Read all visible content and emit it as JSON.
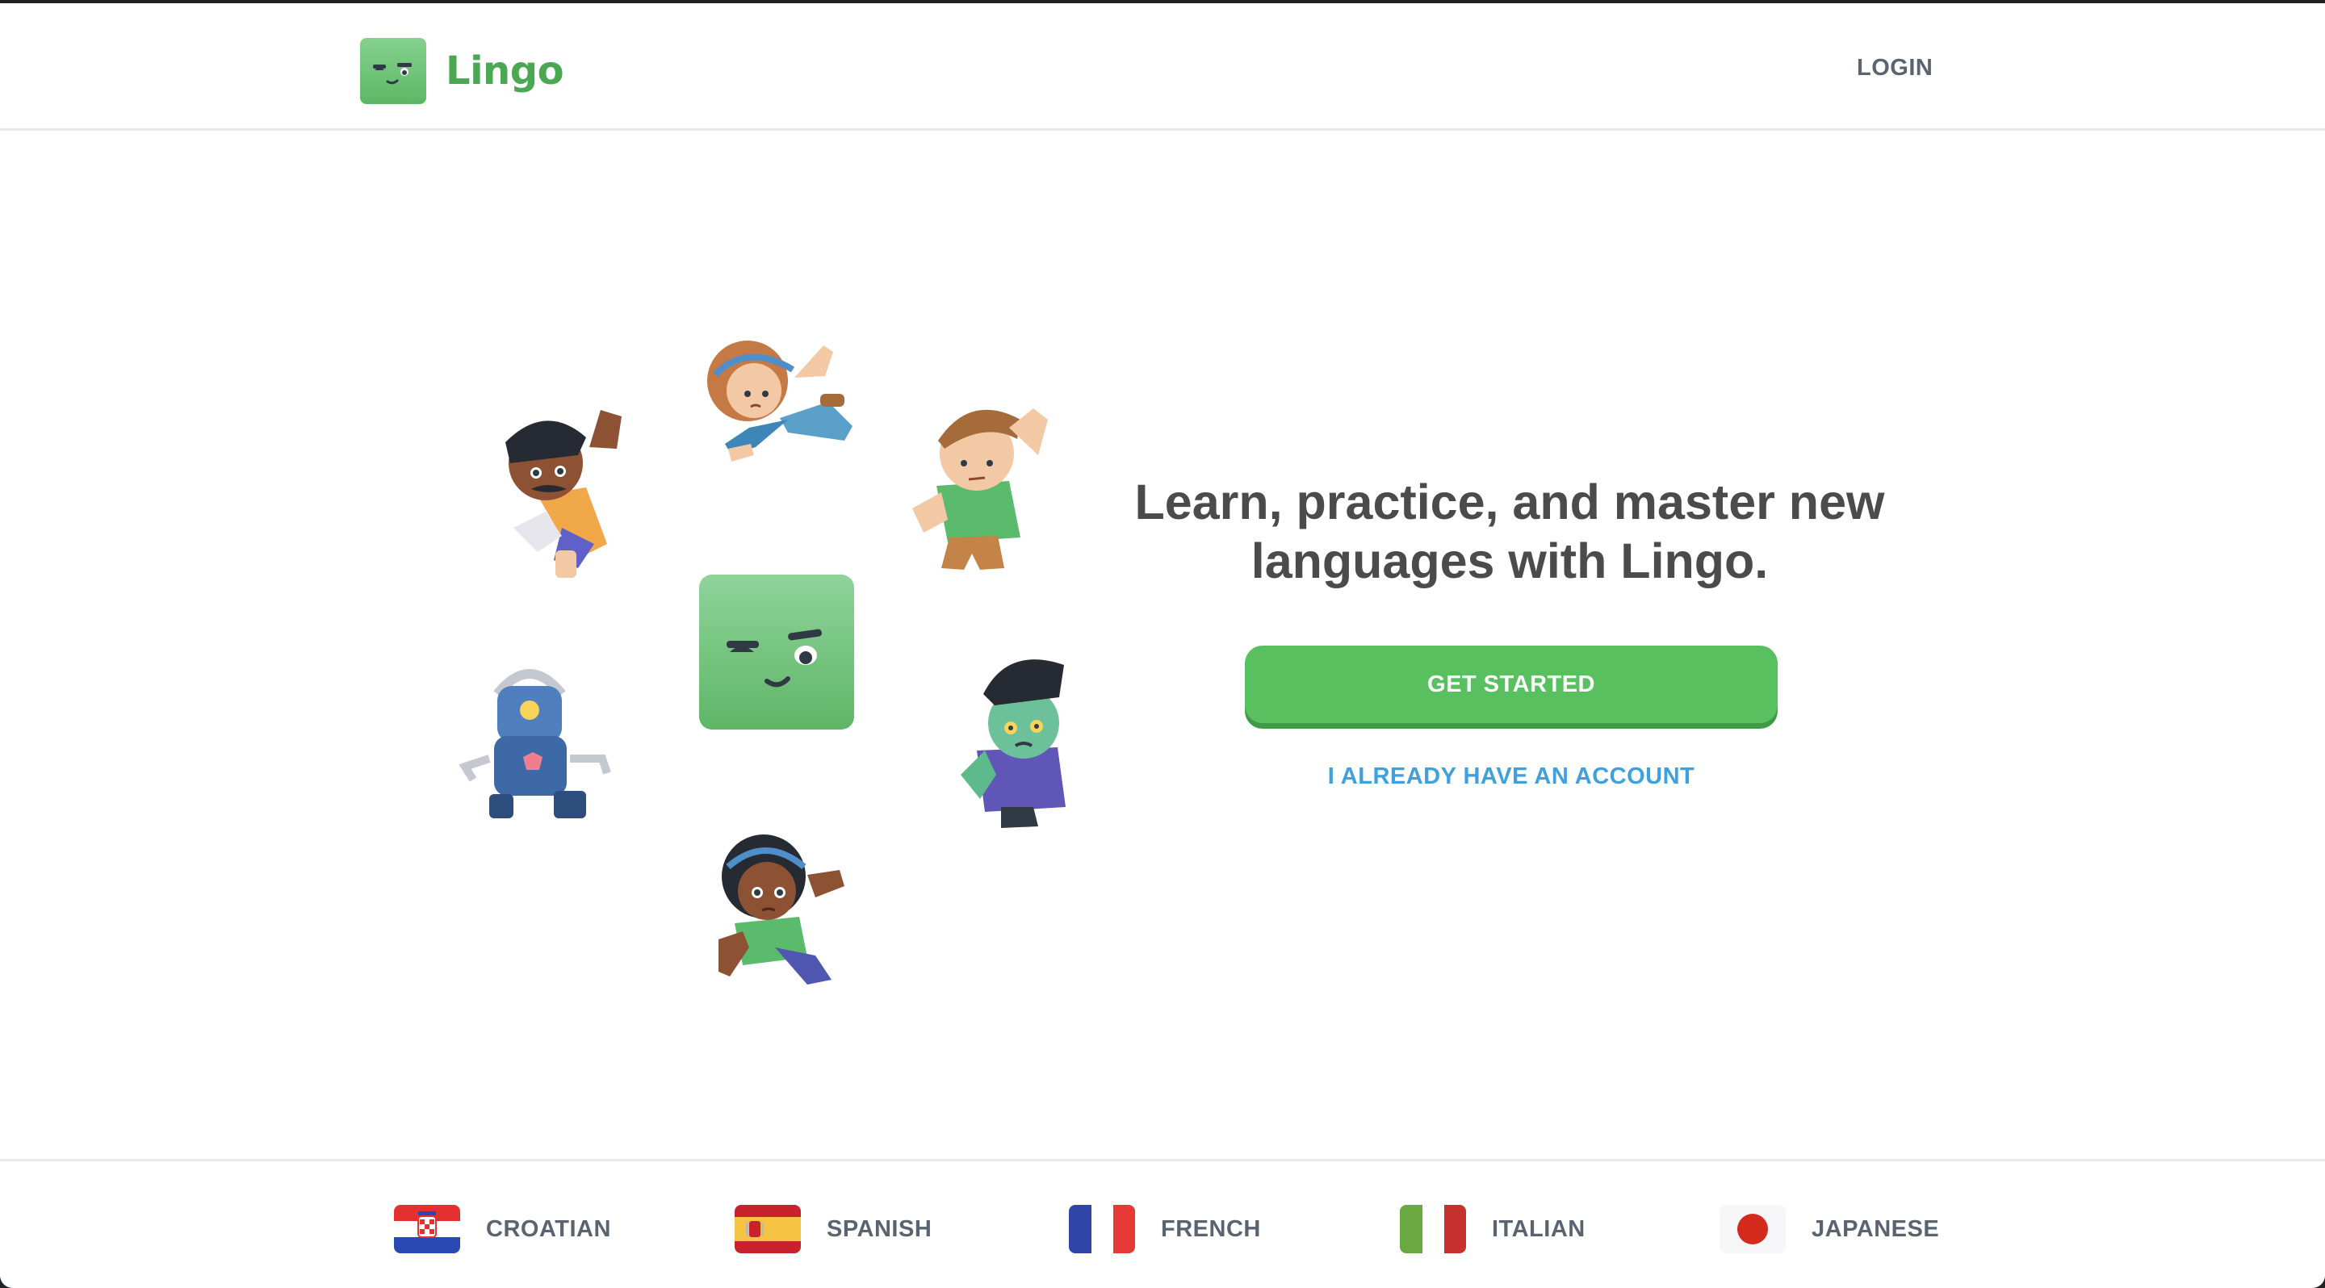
{
  "header": {
    "brand_name": "Lingo",
    "login_label": "LOGIN"
  },
  "hero": {
    "headline_line1": "Learn, practice, and master new",
    "headline_line2": "languages with Lingo.",
    "primary_button": "GET STARTED",
    "secondary_button": "I ALREADY HAVE AN ACCOUNT"
  },
  "languages": [
    {
      "label": "CROATIAN",
      "flag": "croatia-flag"
    },
    {
      "label": "SPANISH",
      "flag": "spain-flag"
    },
    {
      "label": "FRENCH",
      "flag": "france-flag"
    },
    {
      "label": "ITALIAN",
      "flag": "italy-flag"
    },
    {
      "label": "JAPANESE",
      "flag": "japan-flag"
    }
  ],
  "colors": {
    "brand_green": "#4aa752",
    "button_green": "#58c05f",
    "link_blue": "#3fa0df",
    "text_dark": "#4b4b4b",
    "text_gray": "#5a6470"
  }
}
